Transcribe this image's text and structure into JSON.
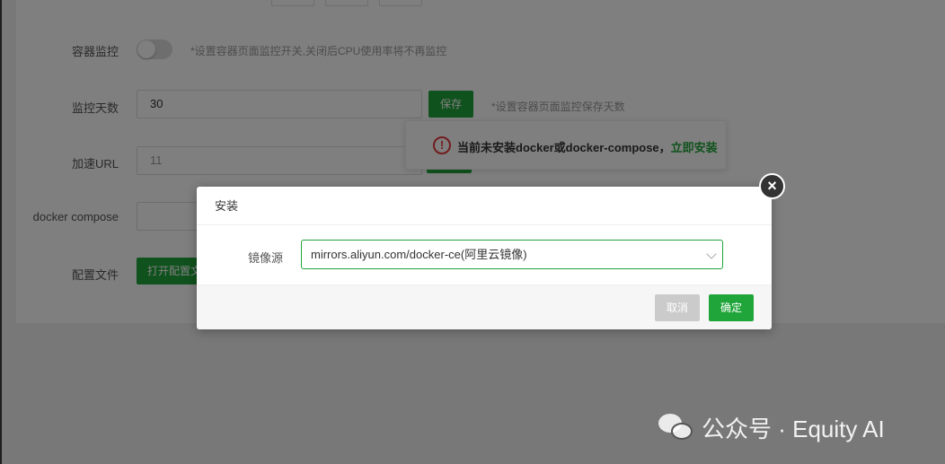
{
  "form": {
    "container_monitor": {
      "label": "容器监控",
      "hint": "*设置容器页面监控开关,关闭后CPU使用率将不再监控",
      "enabled": false
    },
    "monitor_days": {
      "label": "监控天数",
      "value": "30",
      "save_label": "保存",
      "hint": "*设置容器页面监控保存天数"
    },
    "accelerate_url": {
      "label": "加速URL",
      "value": "11"
    },
    "docker_compose": {
      "label": "docker compose"
    },
    "config_file": {
      "label": "配置文件",
      "button_label": "打开配置文"
    }
  },
  "alert": {
    "message": "当前未安装docker或docker-compose，",
    "link": "立即安装",
    "icon": "exclamation-circle-icon",
    "color": "#e4393c"
  },
  "modal": {
    "title": "安装",
    "mirror_label": "镜像源",
    "mirror_value": "mirrors.aliyun.com/docker-ce(阿里云镜像)",
    "cancel_label": "取消",
    "confirm_label": "确定",
    "close_icon": "close-icon"
  },
  "watermark": {
    "text": "公众号 · Equity AI",
    "icon": "wechat-icon"
  },
  "colors": {
    "accent": "#20a53a",
    "danger": "#e4393c"
  }
}
